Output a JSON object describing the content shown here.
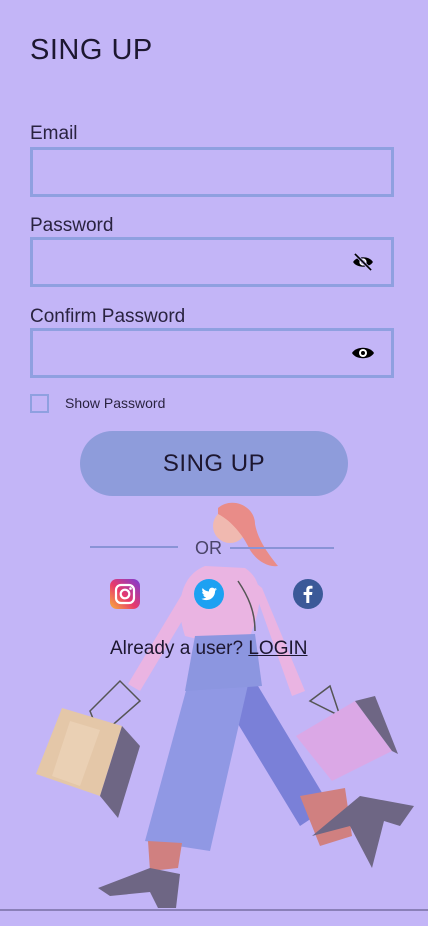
{
  "header": {
    "title": "SING UP"
  },
  "form": {
    "email_label": "Email",
    "email_value": "",
    "password_label": "Password",
    "password_value": "",
    "confirm_label": "Confirm Password",
    "confirm_value": "",
    "show_password_label": "Show Password",
    "show_password_checked": false,
    "submit_label": "SING UP"
  },
  "divider": {
    "text": "OR"
  },
  "social": [
    {
      "icon": "instagram-icon"
    },
    {
      "icon": "twitter-icon"
    },
    {
      "icon": "facebook-icon"
    }
  ],
  "footer": {
    "prompt": "Already a user? ",
    "login_link": "LOGIN"
  },
  "colors": {
    "background": "#c3b5f7",
    "field_border": "#8fa0e0",
    "button": "#8e9cdb"
  }
}
